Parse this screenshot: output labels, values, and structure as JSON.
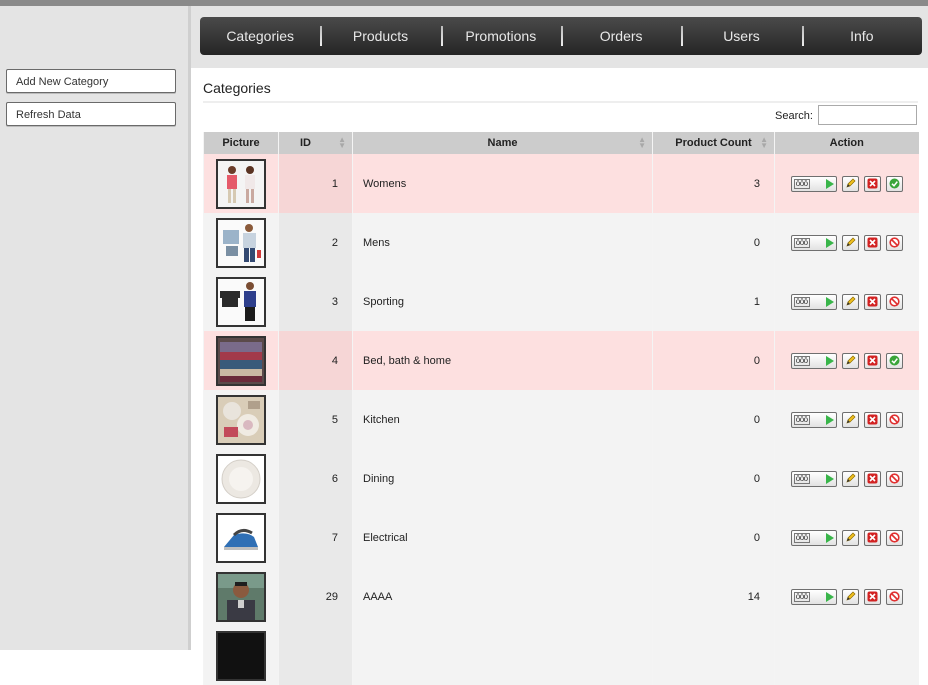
{
  "sidebar": {
    "buttons": [
      "Add New Category",
      "Refresh Data"
    ]
  },
  "nav": {
    "items": [
      "Categories",
      "Products",
      "Promotions",
      "Orders",
      "Users",
      "Info"
    ]
  },
  "page": {
    "title": "Categories",
    "search_label": "Search:",
    "search_value": ""
  },
  "table": {
    "columns": [
      "Picture",
      "ID",
      "Name",
      "Product Count",
      "Action"
    ],
    "rows": [
      {
        "id": "1",
        "name": "Womens",
        "count": "3",
        "status": "active",
        "image": "women-clothing"
      },
      {
        "id": "2",
        "name": "Mens",
        "count": "0",
        "status": "inactive",
        "image": "men-clothing"
      },
      {
        "id": "3",
        "name": "Sporting",
        "count": "1",
        "status": "inactive",
        "image": "sportswear"
      },
      {
        "id": "4",
        "name": "Bed, bath & home",
        "count": "0",
        "status": "active",
        "image": "textiles"
      },
      {
        "id": "5",
        "name": "Kitchen",
        "count": "0",
        "status": "inactive",
        "image": "kitchen-items"
      },
      {
        "id": "6",
        "name": "Dining",
        "count": "0",
        "status": "inactive",
        "image": "white-plate"
      },
      {
        "id": "7",
        "name": "Electrical",
        "count": "0",
        "status": "inactive",
        "image": "steam-iron"
      },
      {
        "id": "29",
        "name": "AAAA",
        "count": "14",
        "status": "inactive",
        "image": "man-portrait"
      }
    ],
    "action_icons": [
      "products-icon",
      "edit-icon",
      "delete-icon",
      "status-icon"
    ],
    "product_button_label": "ōōō"
  },
  "colors": {
    "row_active": "#fde0e0",
    "row_inactive": "#f3f3f3",
    "header": "#cccccc",
    "nav": "#2f2f2f",
    "status_active": "#3aa53a",
    "status_inactive": "#e03030",
    "delete": "#d22222",
    "play": "#39b54a"
  }
}
